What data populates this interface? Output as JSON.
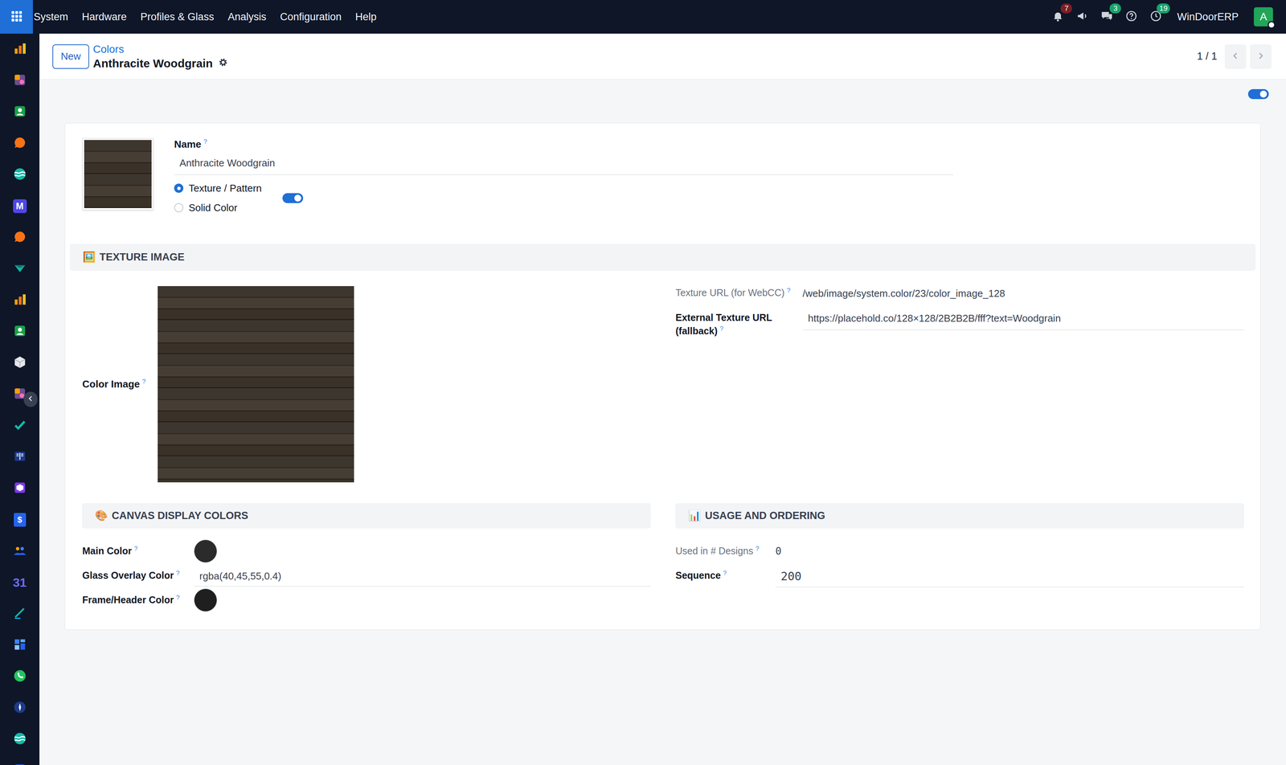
{
  "navbar": {
    "menus": [
      "System",
      "Hardware",
      "Profiles & Glass",
      "Analysis",
      "Configuration",
      "Help"
    ],
    "systray": [
      {
        "kind": "bell",
        "badge": "7",
        "color": "#7a1f24"
      },
      {
        "kind": "megaphone"
      },
      {
        "kind": "chat",
        "badge": "3",
        "color": "#16a36a"
      },
      {
        "kind": "help"
      },
      {
        "kind": "clock",
        "badge": "19",
        "color": "#16a36a"
      }
    ],
    "company": "WinDoorERP",
    "avatar": {
      "initial": "A",
      "online": true
    }
  },
  "sidebar": {
    "items": [
      {
        "kind": "chart"
      },
      {
        "kind": "puzzle"
      },
      {
        "kind": "contact"
      },
      {
        "kind": "bubble"
      },
      {
        "kind": "wave"
      },
      {
        "kind": "letter",
        "label": "M"
      },
      {
        "kind": "bubble"
      },
      {
        "kind": "check"
      },
      {
        "kind": "chart"
      },
      {
        "kind": "contact"
      },
      {
        "kind": "cube"
      },
      {
        "kind": "puzzle"
      },
      {
        "kind": "tick"
      },
      {
        "kind": "book"
      },
      {
        "kind": "box"
      },
      {
        "kind": "invoice",
        "label": "$"
      },
      {
        "kind": "people"
      },
      {
        "kind": "calendar",
        "label": "31"
      },
      {
        "kind": "pen"
      },
      {
        "kind": "dashboard"
      },
      {
        "kind": "whatsapp"
      },
      {
        "kind": "compass"
      },
      {
        "kind": "wave"
      },
      {
        "kind": "app"
      }
    ]
  },
  "control_panel": {
    "new_button": "New",
    "breadcrumb": "Colors",
    "title": "Anthracite Woodgrain",
    "pager": "1 / 1"
  },
  "active_toggle": {
    "on": true
  },
  "form": {
    "name": {
      "label": "Name",
      "help": "?",
      "value": "Anthracite Woodgrain"
    },
    "type_radios": [
      {
        "label": "Texture / Pattern",
        "selected": true
      },
      {
        "label": "Solid Color",
        "selected": false
      }
    ],
    "type_toggle": {
      "on": true
    },
    "texture_section": {
      "icon": "🖼️",
      "title": "TEXTURE IMAGE",
      "image_field": {
        "label": "Color Image",
        "help": "?"
      },
      "fields": [
        {
          "label": "Texture URL (for WebCC)",
          "help": "?",
          "value": "/web/image/system.color/23/color_image_128",
          "readonly": true
        },
        {
          "label": "External Texture URL (fallback)",
          "help": "?",
          "value": "https://placehold.co/128×128/2B2B2B/fff?text=Woodgrain",
          "readonly": false
        }
      ]
    },
    "canvas_section": {
      "icon": "🎨",
      "title": "CANVAS DISPLAY COLORS",
      "fields": [
        {
          "label": "Main Color",
          "help": "?",
          "kind": "swatch",
          "color": "#2b2b2b"
        },
        {
          "label": "Glass Overlay Color",
          "help": "?",
          "kind": "text",
          "value": "rgba(40,45,55,0.4)"
        },
        {
          "label": "Frame/Header Color",
          "help": "?",
          "kind": "swatch",
          "color": "#1f1f1f"
        }
      ]
    },
    "usage_section": {
      "icon": "📊",
      "title": "USAGE AND ORDERING",
      "fields": [
        {
          "label": "Used in # Designs",
          "help": "?",
          "value": "0",
          "readonly": true
        },
        {
          "label": "Sequence",
          "help": "?",
          "value": "200",
          "readonly": false
        }
      ]
    }
  }
}
